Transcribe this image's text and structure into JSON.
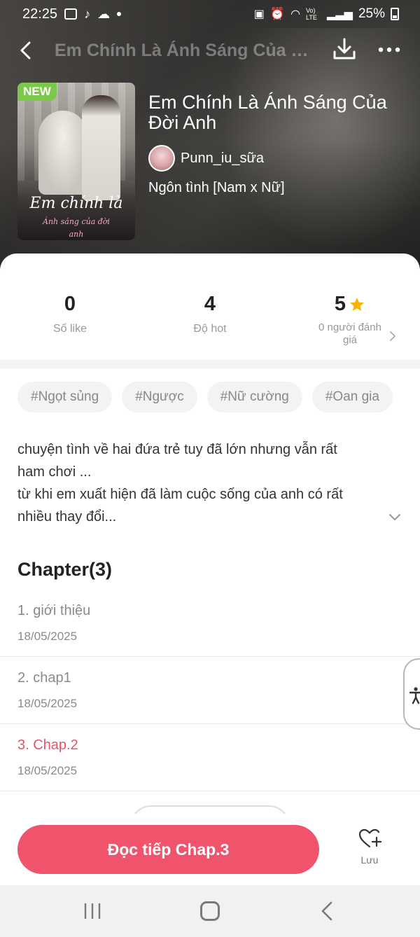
{
  "status_bar": {
    "time": "22:25",
    "network_label": "Vo) LTE",
    "battery": "25%"
  },
  "nav": {
    "title": "Em Chính Là Ánh Sáng Của Đời Anh"
  },
  "book": {
    "badge": "NEW",
    "title": "Em Chính Là Ánh Sáng Của Đời Anh",
    "author": "Punn_iu_sữa",
    "genre": "Ngôn tình [Nam x Nữ]",
    "cover_title": "Em chính là",
    "cover_subtitle_1": "Ánh sáng của đời",
    "cover_subtitle_2": "anh"
  },
  "stats": {
    "likes_value": "0",
    "likes_label": "Số like",
    "hot_value": "4",
    "hot_label": "Độ hot",
    "rating_value": "5",
    "rating_label": "0 người đánh giá"
  },
  "tags": [
    "#Ngọt sủng",
    "#Ngược",
    "#Nữ cường",
    "#Oan gia"
  ],
  "description": {
    "line1": "chuyện tình về hai đứa trẻ tuy đã lớn nhưng vẫn rất",
    "line2": "ham chơi ...",
    "line3": "từ khi em xuất hiện đã làm cuộc sống của anh có rất",
    "line4": "nhiều thay đổi..."
  },
  "chapters": {
    "heading": "Chapter(3)",
    "items": [
      {
        "title": "1. giới thiệu",
        "date": "18/05/2025"
      },
      {
        "title": "2. chap1",
        "date": "18/05/2025"
      },
      {
        "title": "3. Chap.2",
        "date": "18/05/2025"
      }
    ]
  },
  "actions": {
    "read_label": "Đọc tiếp Chap.3",
    "save_label": "Lưu"
  },
  "colors": {
    "accent": "#f0536c",
    "active_chapter": "#e8536a",
    "badge_green": "#7cc84a",
    "star": "#f7b500"
  },
  "icons": [
    "back-arrow-icon",
    "download-icon",
    "more-icon",
    "star-icon",
    "chevron-right-icon",
    "chevron-down-icon",
    "accessibility-icon",
    "heart-plus-icon",
    "recent-apps-icon",
    "home-icon",
    "nav-back-icon"
  ]
}
